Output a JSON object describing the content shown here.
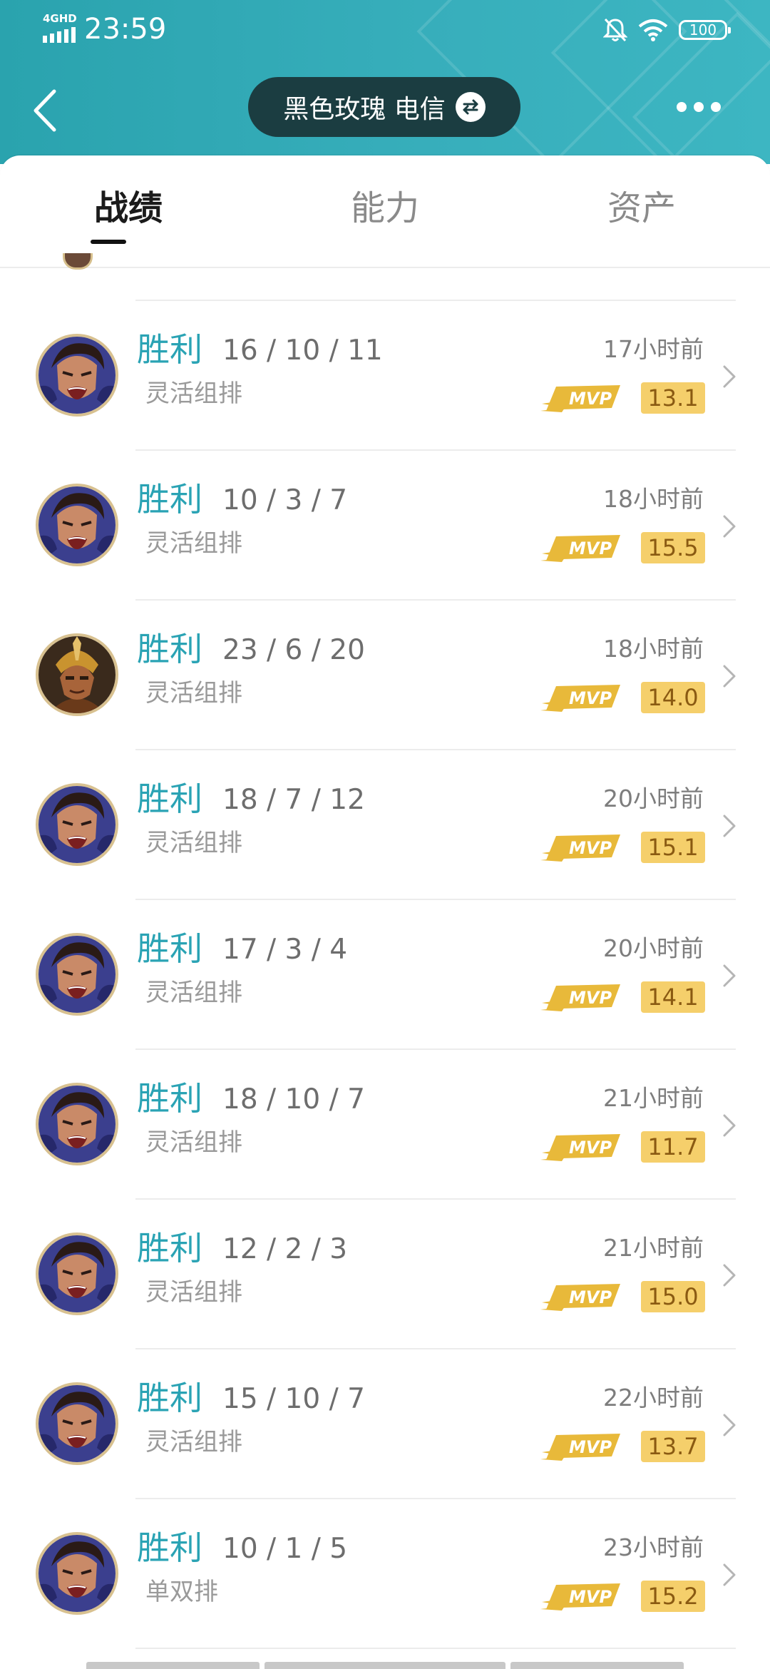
{
  "status_bar": {
    "network": "4GHD",
    "time": "23:59",
    "battery": "100"
  },
  "header": {
    "account_name": "黑色玫瑰 电信"
  },
  "tabs": [
    {
      "label": "战绩",
      "active": true
    },
    {
      "label": "能力",
      "active": false
    },
    {
      "label": "资产",
      "active": false
    }
  ],
  "colors": {
    "header_teal": "#33a9b6",
    "win_text": "#2aa3b4",
    "score_badge": "#f5cf6b",
    "mvp_gold": "#e8b93a"
  },
  "icons": {
    "back": "chevron-left-icon",
    "switch": "switch-account-icon",
    "more": "more-dots-icon",
    "mute": "bell-off-icon",
    "wifi": "wifi-icon",
    "row_arrow": "chevron-right-icon"
  },
  "matches": [
    {
      "result": "胜利",
      "kda": "16 / 10 / 11",
      "mode": "灵活组排",
      "time": "17小时前",
      "mvp": "MVP",
      "score": "13.1",
      "hero": "hero-a"
    },
    {
      "result": "胜利",
      "kda": "10 / 3 / 7",
      "mode": "灵活组排",
      "time": "18小时前",
      "mvp": "MVP",
      "score": "15.5",
      "hero": "hero-a"
    },
    {
      "result": "胜利",
      "kda": "23 / 6 / 20",
      "mode": "灵活组排",
      "time": "18小时前",
      "mvp": "MVP",
      "score": "14.0",
      "hero": "hero-b"
    },
    {
      "result": "胜利",
      "kda": "18 / 7 / 12",
      "mode": "灵活组排",
      "time": "20小时前",
      "mvp": "MVP",
      "score": "15.1",
      "hero": "hero-a"
    },
    {
      "result": "胜利",
      "kda": "17 / 3 / 4",
      "mode": "灵活组排",
      "time": "20小时前",
      "mvp": "MVP",
      "score": "14.1",
      "hero": "hero-a"
    },
    {
      "result": "胜利",
      "kda": "18 / 10 / 7",
      "mode": "灵活组排",
      "time": "21小时前",
      "mvp": "MVP",
      "score": "11.7",
      "hero": "hero-a"
    },
    {
      "result": "胜利",
      "kda": "12 / 2 / 3",
      "mode": "灵活组排",
      "time": "21小时前",
      "mvp": "MVP",
      "score": "15.0",
      "hero": "hero-a"
    },
    {
      "result": "胜利",
      "kda": "15 / 10 / 7",
      "mode": "灵活组排",
      "time": "22小时前",
      "mvp": "MVP",
      "score": "13.7",
      "hero": "hero-a"
    },
    {
      "result": "胜利",
      "kda": "10 / 1 / 5",
      "mode": "单双排",
      "time": "23小时前",
      "mvp": "MVP",
      "score": "15.2",
      "hero": "hero-a"
    }
  ]
}
